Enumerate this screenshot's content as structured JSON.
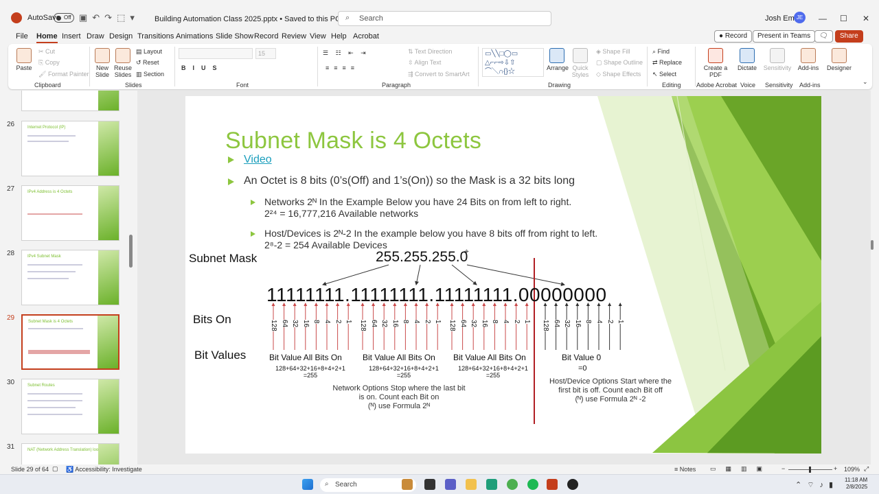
{
  "titlebar": {
    "autosave": "AutoSave",
    "toggle": "Off",
    "file": "Building Automation Class 2025.pptx • Saved to this PC ⌄",
    "search_placeholder": "Search",
    "user": "Josh Emry",
    "initials": "JE"
  },
  "menu": [
    "File",
    "Home",
    "Insert",
    "Draw",
    "Design",
    "Transitions",
    "Animations",
    "Slide Show",
    "Record",
    "Review",
    "View",
    "Help",
    "Acrobat"
  ],
  "header_buttons": {
    "record": "Record",
    "present": "Present in Teams",
    "share": "Share"
  },
  "ribbon": {
    "clipboard": {
      "label": "Clipboard",
      "paste": "Paste",
      "cut": "Cut",
      "copy": "Copy",
      "format_painter": "Format Painter"
    },
    "slides": {
      "label": "Slides",
      "new_slide": "New Slide",
      "reuse": "Reuse Slides",
      "layout": "Layout",
      "reset": "Reset",
      "section": "Section"
    },
    "font": {
      "label": "Font",
      "size": "15"
    },
    "paragraph": {
      "label": "Paragraph",
      "text_direction": "Text Direction",
      "align_text": "Align Text",
      "smartart": "Convert to SmartArt"
    },
    "drawing": {
      "label": "Drawing",
      "arrange": "Arrange",
      "quick_styles": "Quick Styles",
      "fill": "Shape Fill",
      "outline": "Shape Outline",
      "effects": "Shape Effects"
    },
    "editing": {
      "label": "Editing",
      "find": "Find",
      "replace": "Replace",
      "select": "Select"
    },
    "acrobat": {
      "label": "Adobe Acrobat",
      "create": "Create a PDF"
    },
    "voice": {
      "label": "Voice",
      "dictate": "Dictate"
    },
    "sensitivity": {
      "label": "Sensitivity",
      "btn": "Sensitivity"
    },
    "addins": {
      "label": "Add-ins",
      "btn": "Add-ins"
    },
    "designer": {
      "btn": "Designer"
    }
  },
  "thumbnails": [
    {
      "num": "26",
      "title": "Internet Protocol (IP)"
    },
    {
      "num": "27",
      "title": "IPv4 Address is 4 Octets"
    },
    {
      "num": "28",
      "title": "IPv4 Subnet Mask"
    },
    {
      "num": "29",
      "title": "Subnet Mask is 4 Octets"
    },
    {
      "num": "30",
      "title": "Subnet Routes"
    },
    {
      "num": "31",
      "title": "NAT (Network Address Translation) look On Vlan"
    }
  ],
  "slide": {
    "title": "Subnet Mask is 4 Octets",
    "video": "Video",
    "bullet1": "An Octet is 8 bits (0’s(Off) and 1’s(On)) so the Mask is a 32 bits long",
    "sub1_line1": "Networks 2ᴺ In the Example Below you have 24 Bits on from left to right.",
    "sub1_line2": "2²⁴ = 16,777,216 Available networks",
    "sub2_line1": "Host/Devices is 2ᴺ-2 In the example below you have 8 bits off from right to left.",
    "sub2_line2": "2⁸-2 = 254 Available Devices",
    "subnet_label": "Subnet Mask",
    "mask": "255.255.255.0",
    "binary": "11111111.11111111.11111111.00000000",
    "bits_on": "Bits On",
    "bit_values": "Bit Values",
    "bit_value_labels": [
      "128",
      "64",
      "32",
      "16",
      "8",
      "4",
      "2",
      "1"
    ],
    "all_on": "Bit Value All Bits On",
    "all_on_sum": "128+64+32+16+8+4+2+1",
    "all_on_eq": "=255",
    "zero": "Bit Value 0",
    "zero_eq": "=0",
    "network_note_1": "Network Options Stop where the last bit",
    "network_note_2": "is on. Count each Bit on",
    "network_note_3": "(ᴺ) use Formula 2ᴺ",
    "host_note_1": "Host/Device Options Start where the",
    "host_note_2": "first bit is off. Count each Bit off",
    "host_note_3": "(ᴺ) use Formula 2ᴺ -2"
  },
  "status": {
    "slide": "Slide 29 of 64",
    "accessibility": "Accessibility: Investigate",
    "notes": "Notes",
    "zoom": "109%"
  },
  "taskbar": {
    "search": "Search",
    "time": "11:18 AM",
    "date": "2/8/2025"
  },
  "colors": {
    "accent": "#c43e1c",
    "green": "#8dc63f",
    "link": "#1a9ebc",
    "red_line": "#b01e23"
  }
}
